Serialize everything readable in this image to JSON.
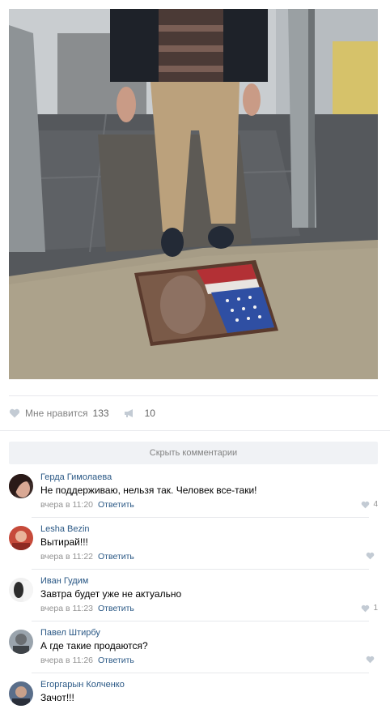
{
  "post": {
    "like_label": "Мне нравится",
    "like_count": "133",
    "share_count": "10",
    "icons": {
      "like": "heart-icon",
      "share": "megaphone-icon"
    }
  },
  "comments_toggle": "Скрыть комментарии",
  "comments": [
    {
      "author": "Герда Гимолаева",
      "text": "Не поддерживаю, нельзя так. Человек все-таки!",
      "time": "вчера в 11:20",
      "reply": "Ответить",
      "likes": "4"
    },
    {
      "author": "Lesha Bezin",
      "text": "Вытирай!!!",
      "time": "вчера в 11:22",
      "reply": "Ответить",
      "likes": ""
    },
    {
      "author": "Иван Гудим",
      "text": "Завтра будет уже не актуально",
      "time": "вчера в 11:23",
      "reply": "Ответить",
      "likes": "1"
    },
    {
      "author": "Павел Штирбу",
      "text": "А где такие продаются?",
      "time": "вчера в 11:26",
      "reply": "Ответить",
      "likes": ""
    },
    {
      "author": "Егоргарын Колченко",
      "text": "Зачот!!!",
      "time": "",
      "reply": "",
      "likes": ""
    }
  ],
  "colors": {
    "link": "#2a5885",
    "muted": "#939393",
    "divider": "#e7e8ec"
  }
}
